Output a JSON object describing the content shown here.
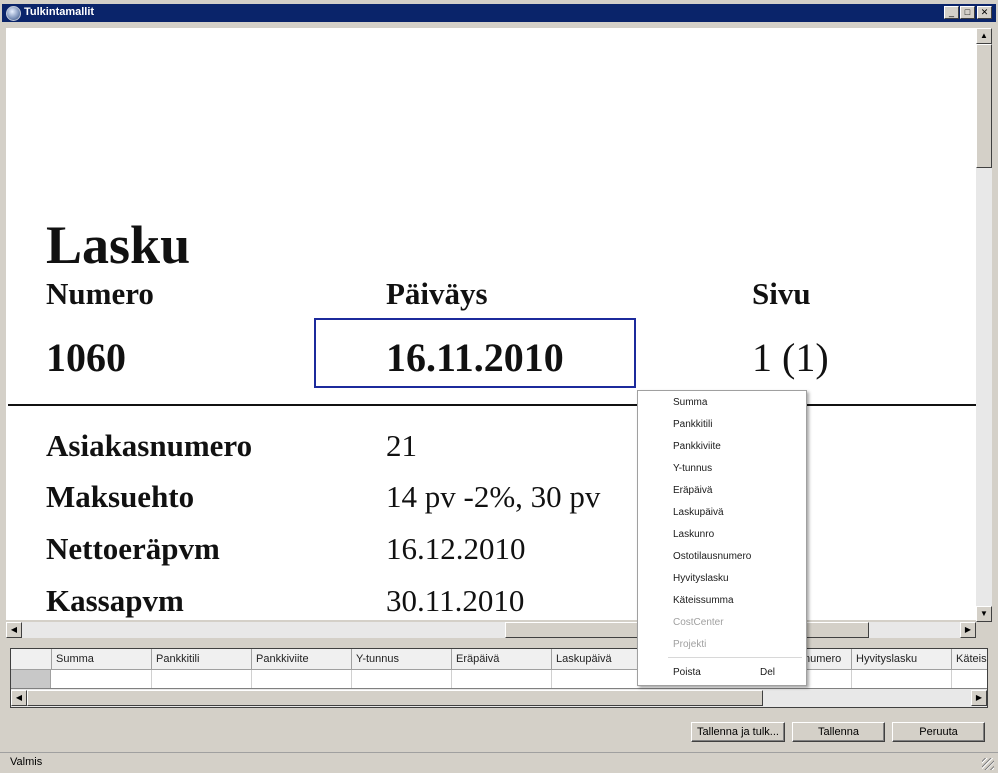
{
  "window": {
    "title": "Tulkintamallit",
    "minimize": "_",
    "maximize": "□",
    "close": "✕"
  },
  "document": {
    "heading": "Lasku",
    "labels": {
      "numero": "Numero",
      "paivays": "Päiväys",
      "sivu": "Sivu"
    },
    "values": {
      "numero": "1060",
      "paivays": "16.11.2010",
      "sivu": "1 (1)"
    },
    "fields": [
      {
        "label": "Asiakasnumero",
        "value": "21"
      },
      {
        "label": "Maksuehto",
        "value": "14 pv -2%, 30 pv"
      },
      {
        "label": "Nettoeräpvm",
        "value": "16.12.2010"
      },
      {
        "label": "Kassapvm",
        "value": "30.11.2010"
      }
    ]
  },
  "context_menu": {
    "items": [
      {
        "label": "Summa",
        "enabled": true
      },
      {
        "label": "Pankkitili",
        "enabled": true
      },
      {
        "label": "Pankkiviite",
        "enabled": true
      },
      {
        "label": "Y-tunnus",
        "enabled": true
      },
      {
        "label": "Eräpäivä",
        "enabled": true
      },
      {
        "label": "Laskupäivä",
        "enabled": true
      },
      {
        "label": "Laskunro",
        "enabled": true
      },
      {
        "label": "Ostotilausnumero",
        "enabled": true
      },
      {
        "label": "Hyvityslasku",
        "enabled": true
      },
      {
        "label": "Käteissumma",
        "enabled": true
      },
      {
        "label": "CostCenter",
        "enabled": false
      },
      {
        "label": "Projekti",
        "enabled": false
      }
    ],
    "delete_label": "Poista",
    "delete_shortcut": "Del"
  },
  "grid": {
    "columns": [
      "Summa",
      "Pankkitili",
      "Pankkiviite",
      "Y-tunnus",
      "Eräpäivä",
      "Laskupäivä",
      "",
      "",
      "numero",
      "Hyvityslasku",
      "Käteis"
    ]
  },
  "buttons": {
    "save_and_interpret": "Tallenna ja tulk...",
    "save": "Tallenna",
    "cancel": "Peruuta"
  },
  "status": {
    "text": "Valmis"
  },
  "scroll_arrows": {
    "up": "▲",
    "down": "▼",
    "left": "◀",
    "right": "▶"
  }
}
